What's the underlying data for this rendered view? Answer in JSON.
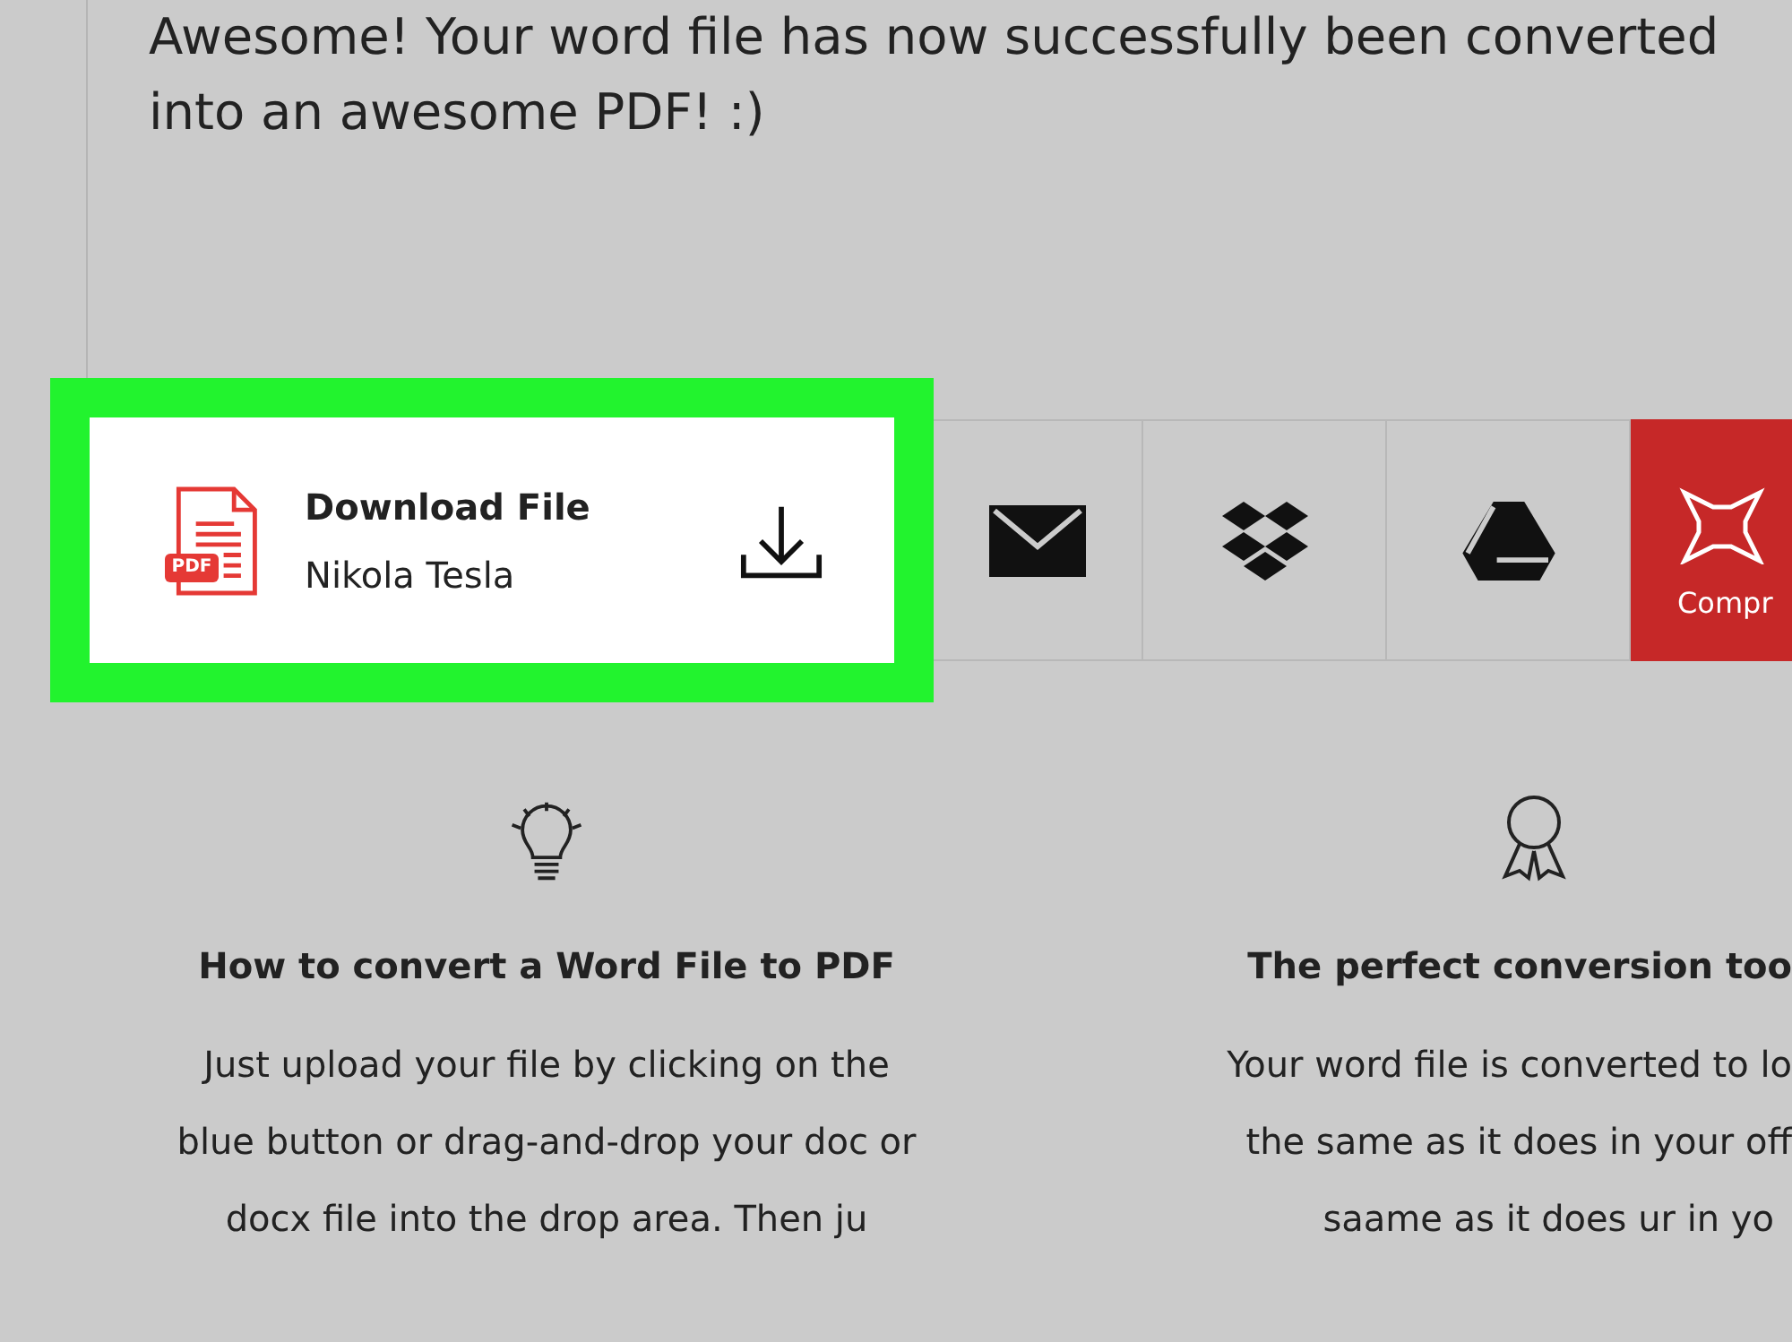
{
  "message": {
    "lines": [
      "Awesome! Your word file has now successfully been converted",
      "into an awesome PDF! :)"
    ]
  },
  "download_card": {
    "badge": "PDF",
    "title": "Download File",
    "file_name": "Nikola Tesla",
    "highlighted": true
  },
  "share_tiles": [
    {
      "kind": "email"
    },
    {
      "kind": "boxes"
    },
    {
      "kind": "drive"
    },
    {
      "kind": "compress",
      "label": "Compr"
    }
  ],
  "features": [
    {
      "kind": "bulb",
      "title": "How to convert a Word File to PDF",
      "lines": [
        "Just upload your file by clicking on the",
        "blue button or drag-and-drop your doc or",
        "docx file into the drop area. Then ju"
      ]
    },
    {
      "kind": "ribbon",
      "title": "The perfect conversion too",
      "lines": [
        "Your word file is converted to lo",
        "the same as it does in your off",
        "saame as it does ur in yo"
      ]
    }
  ]
}
